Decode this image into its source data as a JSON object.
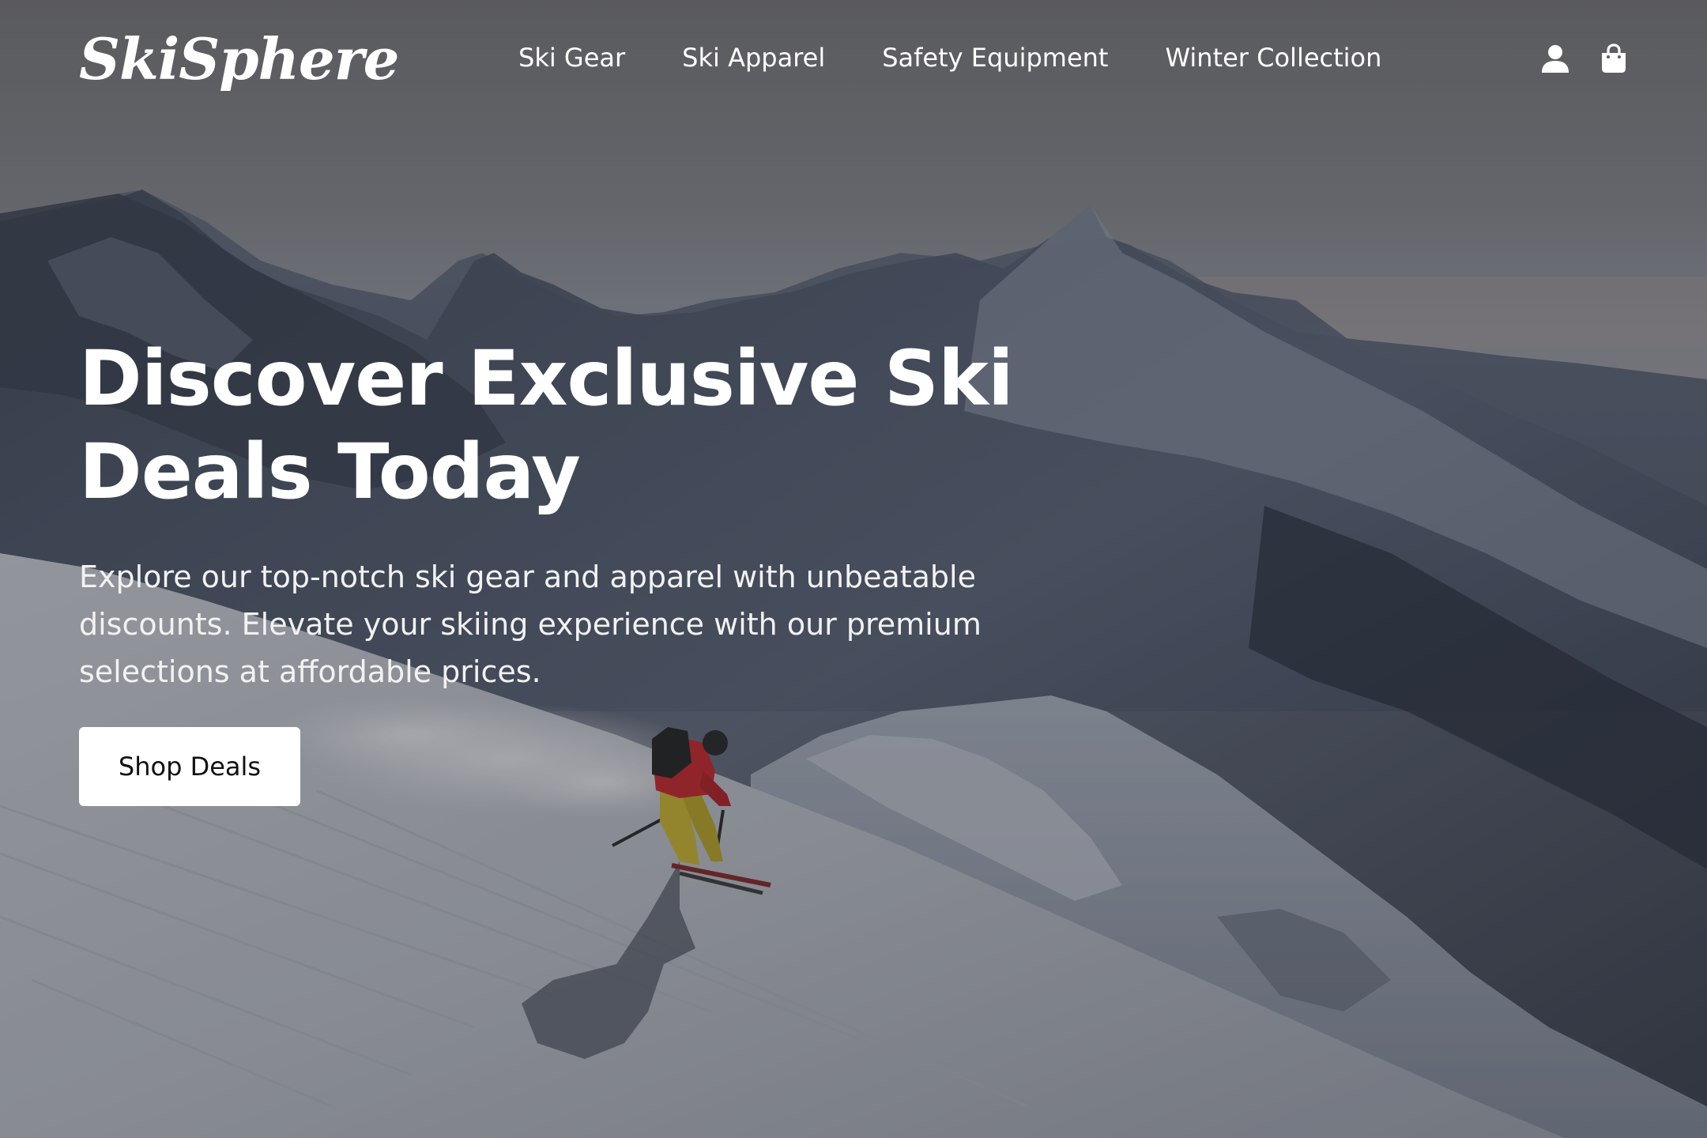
{
  "brand": {
    "logo_text": "SkiSphere"
  },
  "nav": {
    "links": [
      {
        "label": "Ski Gear"
      },
      {
        "label": "Ski Apparel"
      },
      {
        "label": "Safety Equipment"
      },
      {
        "label": "Winter Collection"
      }
    ]
  },
  "header_icons": {
    "account": "user-icon",
    "cart": "shopping-bag-icon"
  },
  "hero": {
    "title": "Discover Exclusive Ski Deals Today",
    "description": "Explore our top-notch ski gear and apparel with unbeatable discounts. Elevate your skiing experience with our premium selections at affordable prices.",
    "cta_label": "Shop Deals"
  },
  "colors": {
    "text": "#ffffff",
    "button_bg": "#ffffff",
    "button_text": "#111111"
  }
}
